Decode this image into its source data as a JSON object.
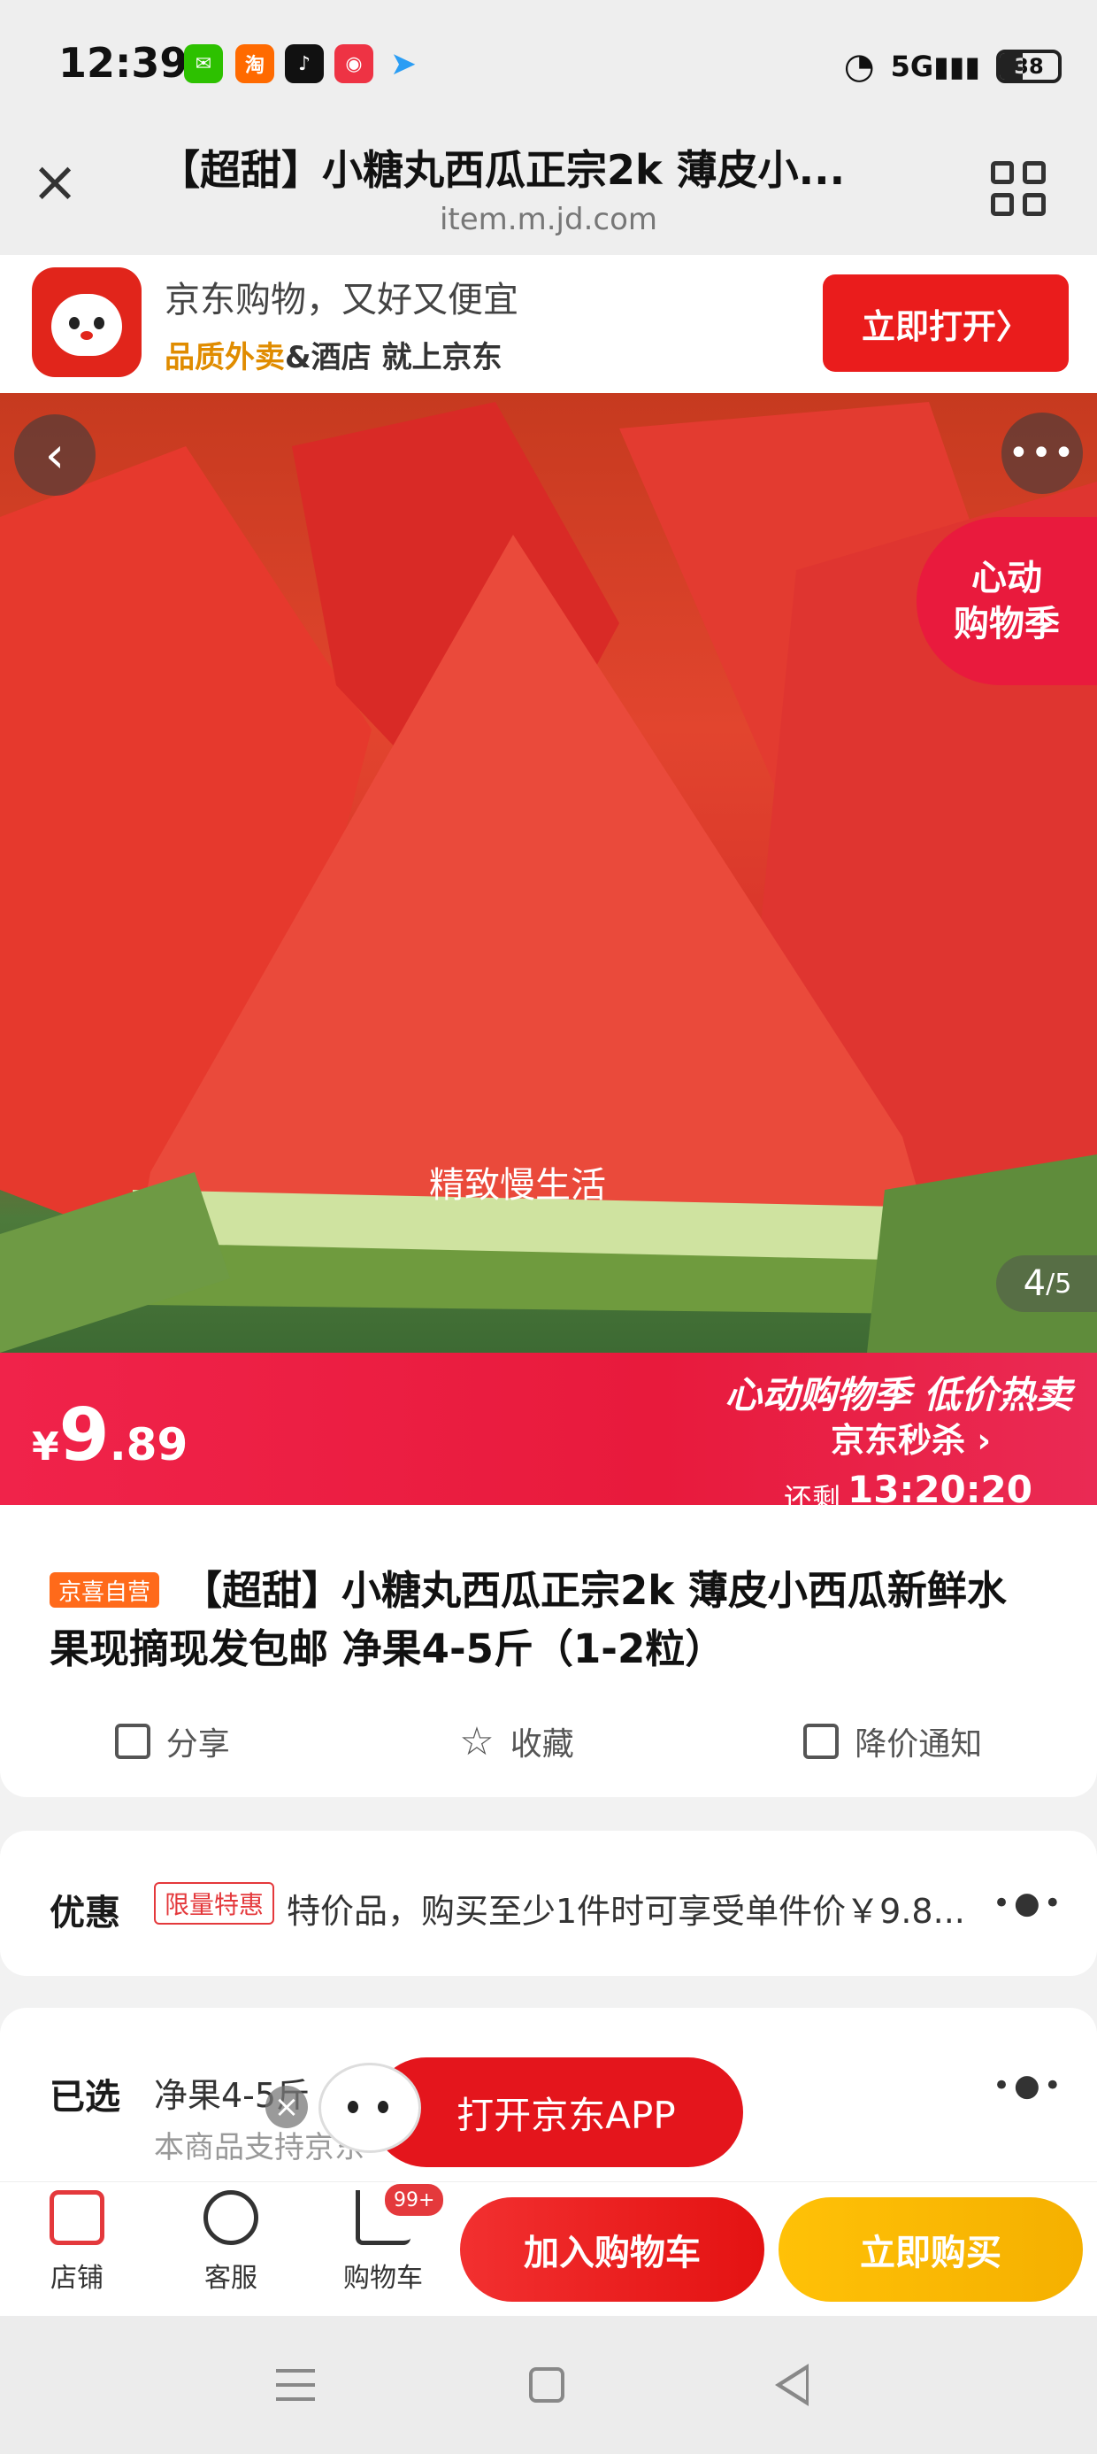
{
  "status_bar": {
    "time": "12:39",
    "app_icons": [
      "wechat-icon",
      "taobao-icon",
      "tiktok-icon",
      "app-icon",
      "telegram-icon"
    ],
    "battery": "38"
  },
  "title_bar": {
    "title": "【超甜】小糖丸西瓜正宗2k 薄皮小...",
    "url": "item.m.jd.com"
  },
  "jd_banner": {
    "line1": "京东购物，又好又便宜",
    "line2_highlight": "品质外卖",
    "line2_rest": "&酒店 就上京东",
    "open_button": "立即打开〉"
  },
  "hero": {
    "caption": "精致慢生活",
    "badge_line1": "心动",
    "badge_line2": "购物季",
    "pager_current": "4",
    "pager_total": "/5"
  },
  "price": {
    "yen": "¥",
    "integer": "9",
    "decimal": ".89",
    "promo_title": "心动购物季 低价热卖",
    "seckill": "京东秒杀 ›",
    "countdown_label": "还剩",
    "countdown": "13:20:20"
  },
  "product": {
    "tag": "京喜自营",
    "title": "【超甜】小糖丸西瓜正宗2k 薄皮小西瓜新鲜水果现摘现发包邮 净果4-5斤（1-2粒）",
    "share": "分享",
    "favorite": "收藏",
    "price_alert": "降价通知"
  },
  "discount": {
    "label": "优惠",
    "tag": "限量特惠",
    "text": "特价品，购买至少1件时可享受单件价￥9.8...",
    "more": "•●•"
  },
  "selected": {
    "label": "已选",
    "value": "净果4-5斤",
    "sub": "本商品支持京东",
    "more": "•●•"
  },
  "float_app": {
    "label": "打开京东APP",
    "close": "×"
  },
  "bottom_bar": {
    "shop": "店铺",
    "service": "客服",
    "cart": "购物车",
    "cart_badge": "99+",
    "add_cart": "加入购物车",
    "buy_now": "立即购买"
  },
  "colors": {
    "jd_red": "#e4393c",
    "price_red": "#e81a3c",
    "buy_yellow": "#f5b000"
  }
}
